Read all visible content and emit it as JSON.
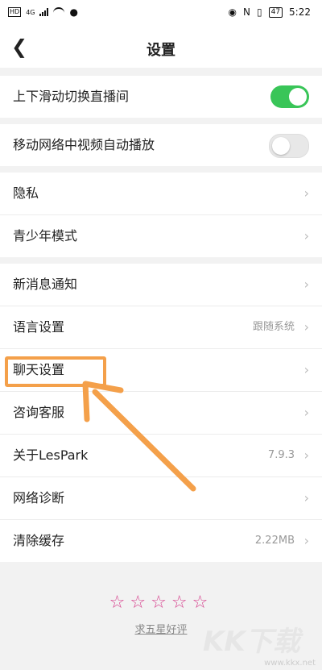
{
  "status": {
    "network": "4G",
    "battery": "47",
    "time": "5:22"
  },
  "nav": {
    "back_icon": "chevron-left-icon",
    "title": "设置"
  },
  "toggles": [
    {
      "label": "上下滑动切换直播间",
      "enabled": true
    },
    {
      "label": "移动网络中视频自动播放",
      "enabled": false
    }
  ],
  "privacy": [
    {
      "label": "隐私"
    },
    {
      "label": "青少年模式"
    }
  ],
  "general": [
    {
      "label": "新消息通知"
    },
    {
      "label": "语言设置",
      "value": "跟随系统"
    },
    {
      "label": "聊天设置"
    },
    {
      "label": "咨询客服"
    },
    {
      "label": "关于LesPark",
      "value": "7.9.3"
    },
    {
      "label": "网络诊断"
    },
    {
      "label": "清除缓存",
      "value": "2.22MB"
    }
  ],
  "rating": {
    "star_count": 5,
    "link": "求五星好评"
  },
  "watermark": {
    "logo": "KK下载",
    "url": "www.kkx.net"
  },
  "colors": {
    "toggle_on": "#39c558",
    "highlight": "#f4a04a",
    "star": "#d63f8c"
  }
}
